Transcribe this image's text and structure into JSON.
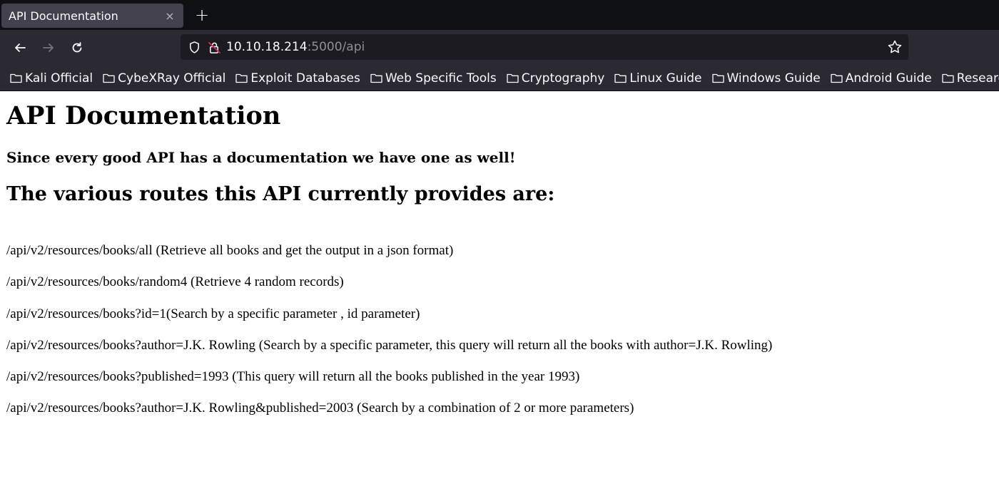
{
  "browser": {
    "tab": {
      "title": "API Documentation",
      "close_glyph": "×"
    },
    "new_tab_glyph": "+",
    "nav": {
      "back_icon": "back-arrow-icon",
      "forward_icon": "forward-arrow-icon",
      "reload_icon": "reload-icon"
    },
    "url": {
      "host": "10.10.18.214",
      "rest": ":5000/api"
    },
    "bookmarks": [
      {
        "label": "Kali Official"
      },
      {
        "label": "CybeXRay Official"
      },
      {
        "label": "Exploit Databases"
      },
      {
        "label": "Web Specific Tools"
      },
      {
        "label": "Cryptography"
      },
      {
        "label": "Linux Guide"
      },
      {
        "label": "Windows Guide"
      },
      {
        "label": "Android Guide"
      },
      {
        "label": "Research"
      }
    ],
    "colors": {
      "tabbar": "#0f1014",
      "toolbar": "#2b2a33",
      "urlbar": "#1c1b22",
      "active_tab": "#42414d",
      "insecure_lock": "#e22850"
    }
  },
  "page": {
    "title": "API Documentation",
    "subtitle": "Since every good API has a documentation we have one as well!",
    "routes_heading": "The various routes this API currently provides are:",
    "routes": [
      "/api/v2/resources/books/all (Retrieve all books and get the output in a json format)",
      "/api/v2/resources/books/random4 (Retrieve 4 random records)",
      "/api/v2/resources/books?id=1(Search by a specific parameter , id parameter)",
      "/api/v2/resources/books?author=J.K. Rowling (Search by a specific parameter, this query will return all the books with author=J.K. Rowling)",
      "/api/v2/resources/books?published=1993 (This query will return all the books published in the year 1993)",
      "/api/v2/resources/books?author=J.K. Rowling&published=2003 (Search by a combination of 2 or more parameters)"
    ]
  }
}
